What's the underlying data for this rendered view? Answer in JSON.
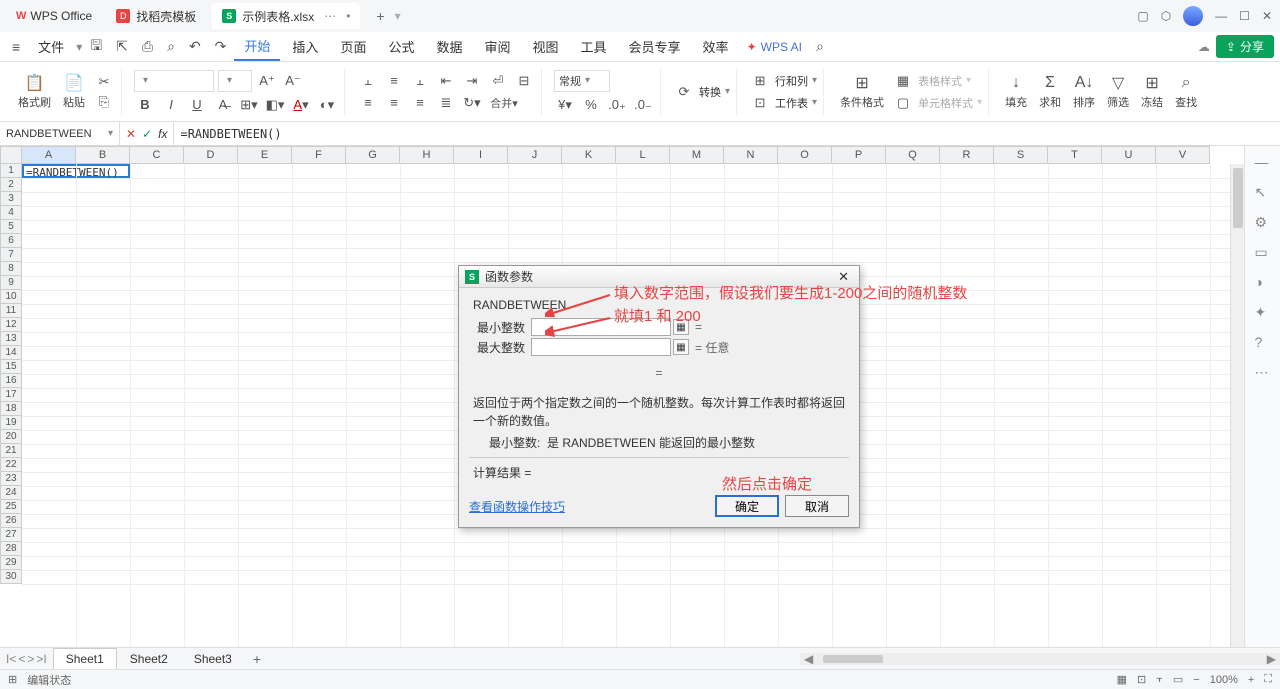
{
  "titlebar": {
    "app_name": "WPS Office",
    "tabs": [
      {
        "icon": "D",
        "label": "找稻壳模板"
      },
      {
        "icon": "S",
        "label": "示例表格.xlsx"
      }
    ],
    "plus": "+"
  },
  "menubar": {
    "file": "文件",
    "items": [
      "开始",
      "插入",
      "页面",
      "公式",
      "数据",
      "审阅",
      "视图",
      "工具",
      "会员专享",
      "效率"
    ],
    "active": "开始",
    "wpsai": "WPS AI",
    "share": "分享"
  },
  "ribbon": {
    "format_painter": "格式刷",
    "paste": "粘贴",
    "number_format": "常规",
    "convert": "转换",
    "rowcol": "行和列",
    "worksheet": "工作表",
    "cond_format": "条件格式",
    "table_style": "表格样式",
    "cell_style": "单元格样式",
    "fill": "填充",
    "sum": "求和",
    "sort": "排序",
    "filter": "筛选",
    "freeze": "冻结",
    "find": "查找"
  },
  "formula_bar": {
    "name_box": "RANDBETWEEN",
    "fx": "fx",
    "value": "=RANDBETWEEN()"
  },
  "sheet": {
    "columns": [
      "A",
      "B",
      "C",
      "D",
      "E",
      "F",
      "G",
      "H",
      "I",
      "J",
      "K",
      "L",
      "M",
      "N",
      "O",
      "P",
      "Q",
      "R",
      "S",
      "T",
      "U",
      "V"
    ],
    "rows": 30,
    "a1": "=RANDBETWEEN()"
  },
  "sheet_tabs": {
    "sheets": [
      "Sheet1",
      "Sheet2",
      "Sheet3"
    ],
    "active": "Sheet1"
  },
  "status_bar": {
    "mode": "编辑状态",
    "zoom": "100%"
  },
  "dialog": {
    "title": "函数参数",
    "function": "RANDBETWEEN",
    "arg1_label": "最小整数",
    "arg2_label": "最大整数",
    "arg2_hint": "= 任意",
    "eq_center": "=",
    "desc": "返回位于两个指定数之间的一个随机整数。每次计算工作表时都将返回一个新的数值。",
    "desc2_label": "最小整数:",
    "desc2_text": "是 RANDBETWEEN 能返回的最小整数",
    "result_label": "计算结果 =",
    "link": "查看函数操作技巧",
    "ok": "确定",
    "cancel": "取消"
  },
  "annotations": {
    "line1": "填入数字范围，假设我们要生成1-200之间的随机整数",
    "line2": "就填1 和 200",
    "line3": "然后点击确定"
  }
}
